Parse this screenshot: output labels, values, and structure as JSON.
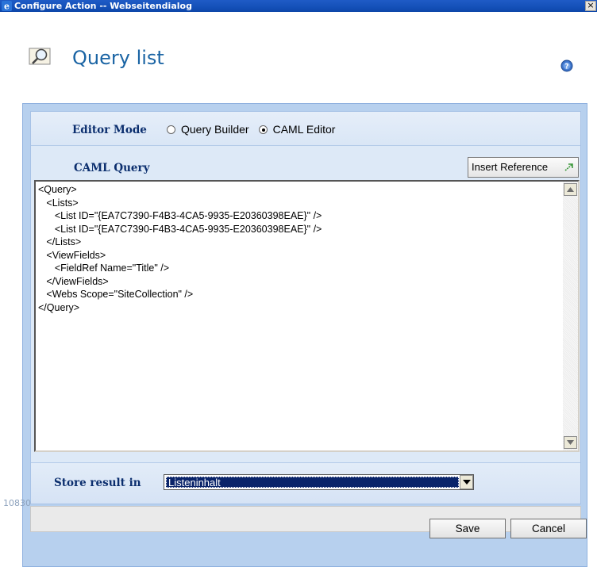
{
  "window": {
    "title": "Configure Action -- Webseitendialog",
    "close_label": "×"
  },
  "header": {
    "title": "Query list"
  },
  "editor_mode": {
    "label": "Editor Mode",
    "options": [
      {
        "label": "Query Builder",
        "checked": false
      },
      {
        "label": "CAML Editor",
        "checked": true
      }
    ]
  },
  "caml": {
    "label": "CAML Query",
    "insert_button": "Insert Reference",
    "content": "<Query>\n   <Lists>\n      <List ID=\"{EA7C7390-F4B3-4CA5-9935-E20360398EAE}\" />\n      <List ID=\"{EA7C7390-F4B3-4CA5-9935-E20360398EAE}\" />\n   </Lists>\n   <ViewFields>\n      <FieldRef Name=\"Title\" />\n   </ViewFields>\n   <Webs Scope=\"SiteCollection\" />\n</Query>"
  },
  "store": {
    "label": "Store result in",
    "selected": "Listeninhalt"
  },
  "footer": {
    "id_text": "10830",
    "save_label": "Save",
    "cancel_label": "Cancel"
  },
  "colors": {
    "titlebar": "#1450b8",
    "page_title": "#1a64a4",
    "frame": "#b7d0ee",
    "label": "#0b2e6e",
    "selected": "#0a246a"
  },
  "icons": {
    "app": "ie-icon",
    "header": "magnifier-query-icon",
    "help": "help-icon",
    "insert": "arrow-icon",
    "scroll_up": "scroll-up-icon",
    "scroll_down": "scroll-down-icon",
    "dropdown": "chevron-down-icon"
  }
}
